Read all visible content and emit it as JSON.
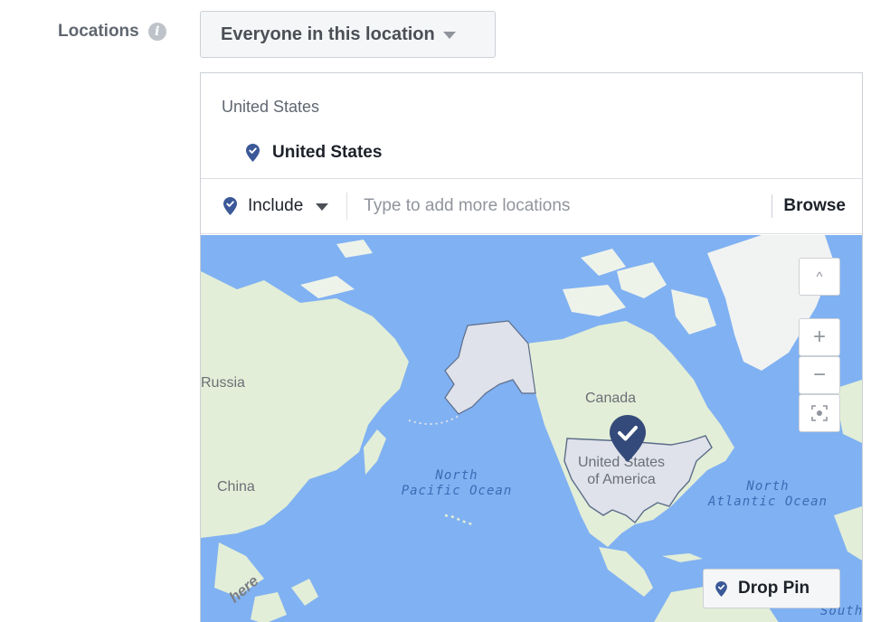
{
  "field": {
    "label": "Locations",
    "info_icon": "info-icon"
  },
  "audience_select": {
    "selected": "Everyone in this location"
  },
  "panel": {
    "group_heading": "United States",
    "selected_location": "United States"
  },
  "include_bar": {
    "include_label": "Include",
    "search_placeholder": "Type to add more locations",
    "search_value": "",
    "browse_label": "Browse"
  },
  "map": {
    "labels": {
      "russia": "Russia",
      "canada": "Canada",
      "china": "China",
      "usa_line1": "United States",
      "usa_line2": "of America",
      "north_pacific_line1": "North",
      "north_pacific_line2": "Pacific Ocean",
      "north_atlantic_line1": "North",
      "north_atlantic_line2": "Atlantic Ocean",
      "south": "South"
    },
    "watermark": "here",
    "controls": {
      "scroll_up": "^",
      "zoom_in": "+",
      "zoom_out": "−",
      "recenter_icon": "target-icon"
    },
    "drop_pin_label": "Drop Pin"
  },
  "colors": {
    "brand_pin": "#3b5998",
    "water": "#80b1f2",
    "land": "#e2eed7",
    "selected_country": "#dfe2ea"
  }
}
